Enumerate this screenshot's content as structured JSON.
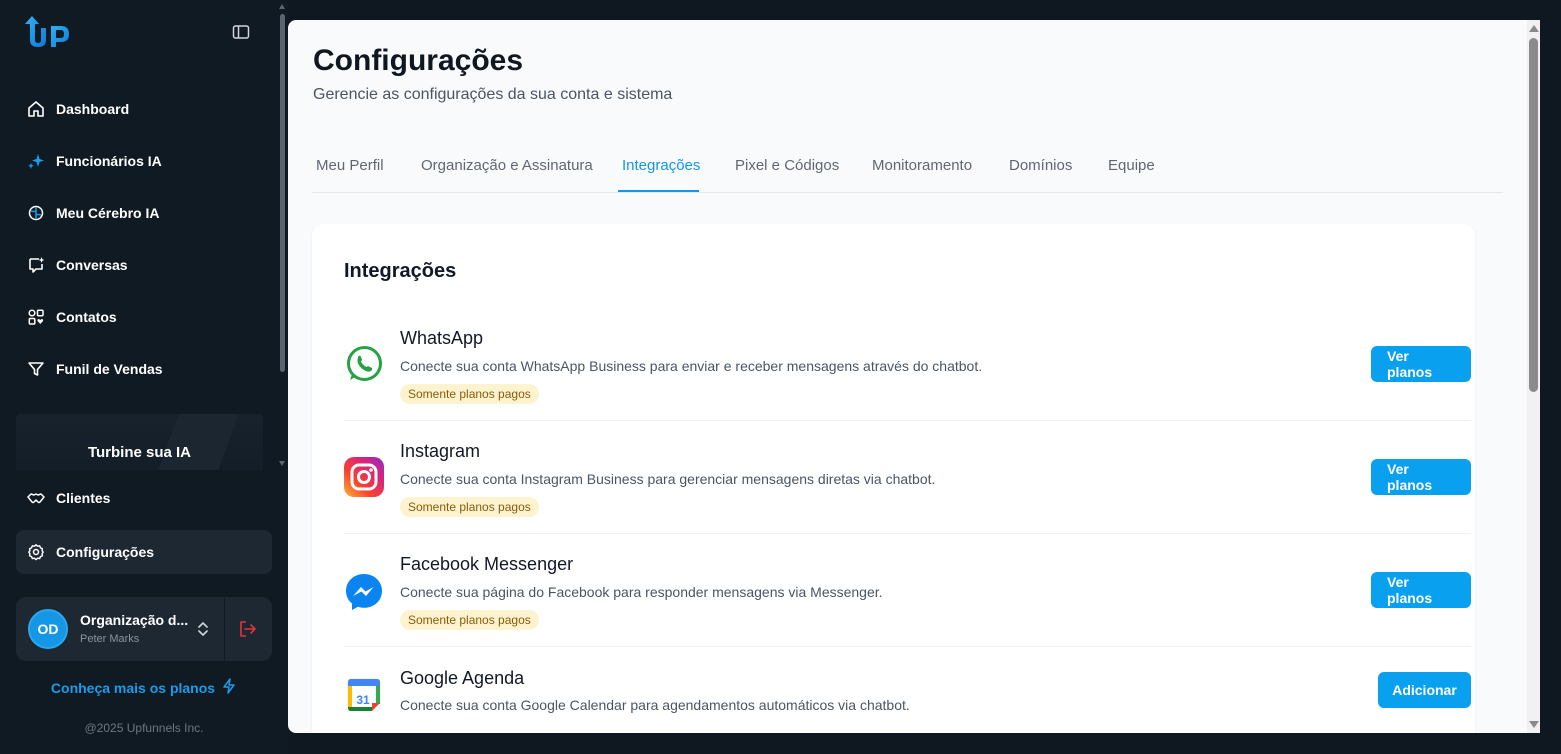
{
  "sidebar": {
    "logo_text": "UP",
    "nav": [
      {
        "label": "Dashboard",
        "icon": "home-icon"
      },
      {
        "label": "Funcionários IA",
        "icon": "sparkles-icon"
      },
      {
        "label": "Meu Cérebro IA",
        "icon": "brain-icon"
      },
      {
        "label": "Conversas",
        "icon": "chat-icon"
      },
      {
        "label": "Contatos",
        "icon": "contacts-icon"
      },
      {
        "label": "Funil de Vendas",
        "icon": "funnel-icon"
      },
      {
        "label": "Clientes",
        "icon": "handshake-icon"
      },
      {
        "label": "Configurações",
        "icon": "gear-icon"
      }
    ],
    "promo_title": "Turbine sua IA",
    "org": {
      "initials": "OD",
      "name": "Organização d...",
      "user": "Peter Marks"
    },
    "plans_link": "Conheça mais os planos",
    "copyright": "@2025 Upfunnels Inc."
  },
  "page": {
    "title": "Configurações",
    "subtitle": "Gerencie as configurações da sua conta e sistema"
  },
  "tabs": [
    {
      "label": "Meu Perfil"
    },
    {
      "label": "Organização e Assinatura"
    },
    {
      "label": "Integrações"
    },
    {
      "label": "Pixel e Códigos"
    },
    {
      "label": "Monitoramento"
    },
    {
      "label": "Domínios"
    },
    {
      "label": "Equipe"
    }
  ],
  "active_tab": "Integrações",
  "integrations": {
    "title": "Integrações",
    "items": [
      {
        "name": "WhatsApp",
        "description": "Conecte sua conta WhatsApp Business para enviar e receber mensagens através do chatbot.",
        "badge": "Somente planos pagos",
        "button": "Ver planos",
        "icon": "whatsapp-icon"
      },
      {
        "name": "Instagram",
        "description": "Conecte sua conta Instagram Business para gerenciar mensagens diretas via chatbot.",
        "badge": "Somente planos pagos",
        "button": "Ver planos",
        "icon": "instagram-icon"
      },
      {
        "name": "Facebook Messenger",
        "description": "Conecte sua página do Facebook para responder mensagens via Messenger.",
        "badge": "Somente planos pagos",
        "button": "Ver planos",
        "icon": "messenger-icon"
      },
      {
        "name": "Google Agenda",
        "description": "Conecte sua conta Google Calendar para agendamentos automáticos via chatbot.",
        "button": "Adicionar",
        "icon": "google-calendar-icon",
        "calendar_day": "31"
      }
    ]
  },
  "colors": {
    "accent": "#1597e5",
    "sidebar_bg": "#101a23",
    "button_bg": "#0aa0f0",
    "badge_bg": "#fdf3cf"
  }
}
